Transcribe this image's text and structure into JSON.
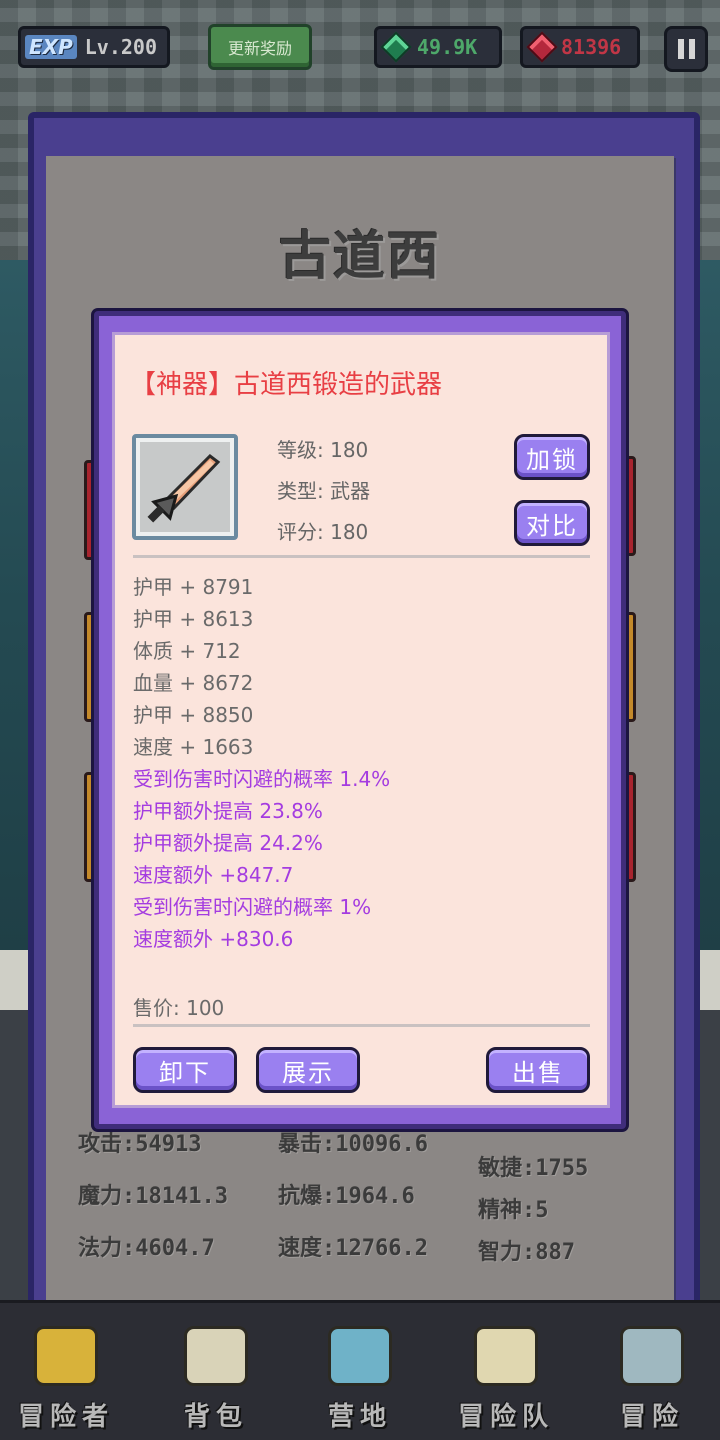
{
  "hud": {
    "exp_tag": "EXP",
    "level": "Lv.200",
    "reward_button": "更新奖励",
    "gems": "49.9K",
    "rubies": "81396"
  },
  "character": {
    "name": "古道西",
    "stats": [
      {
        "label": "攻击:",
        "value": "54913"
      },
      {
        "label": "暴击:",
        "value": "10096.6"
      },
      {
        "label": "敏捷:",
        "value": "1755"
      },
      {
        "label": "魔力:",
        "value": "18141.3"
      },
      {
        "label": "抗爆:",
        "value": "1964.6"
      },
      {
        "label": "精神:",
        "value": "5"
      },
      {
        "label": "法力:",
        "value": "4604.7"
      },
      {
        "label": "速度:",
        "value": "12766.2"
      },
      {
        "label": "智力:",
        "value": "887"
      }
    ]
  },
  "item": {
    "title": "【神器】古道西锻造的武器",
    "level_label": "等级:",
    "level": "180",
    "type_label": "类型:",
    "type": "武器",
    "score_label": "评分:",
    "score": "180",
    "lock_button": "加锁",
    "compare_button": "对比",
    "base_attrs": [
      "护甲 + 8791",
      "护甲 + 8613",
      "体质 + 712",
      "血量 + 8672",
      "护甲 + 8850",
      "速度 + 1663"
    ],
    "extra_attrs": [
      "受到伤害时闪避的概率 1.4%",
      "护甲额外提高 23.8%",
      "护甲额外提高 24.2%",
      "速度额外 +847.7",
      "受到伤害时闪避的概率 1%",
      "速度额外 +830.6"
    ],
    "sell_price_label": "售价:",
    "sell_price": "100",
    "unequip_button": "卸下",
    "show_button": "展示",
    "sell_button": "出售"
  },
  "nav": [
    {
      "label": "冒险者",
      "icon": "helmet-icon"
    },
    {
      "label": "背包",
      "icon": "backpack-icon"
    },
    {
      "label": "营地",
      "icon": "camp-banner-icon"
    },
    {
      "label": "冒险队",
      "icon": "book-icon"
    },
    {
      "label": "冒险",
      "icon": "sword-icon"
    }
  ],
  "colors": {
    "rarity_title": "#e83f44",
    "extra_attr": "#a43ce0",
    "button": "#9a80f0",
    "modal_frame": "#8a63d6"
  }
}
